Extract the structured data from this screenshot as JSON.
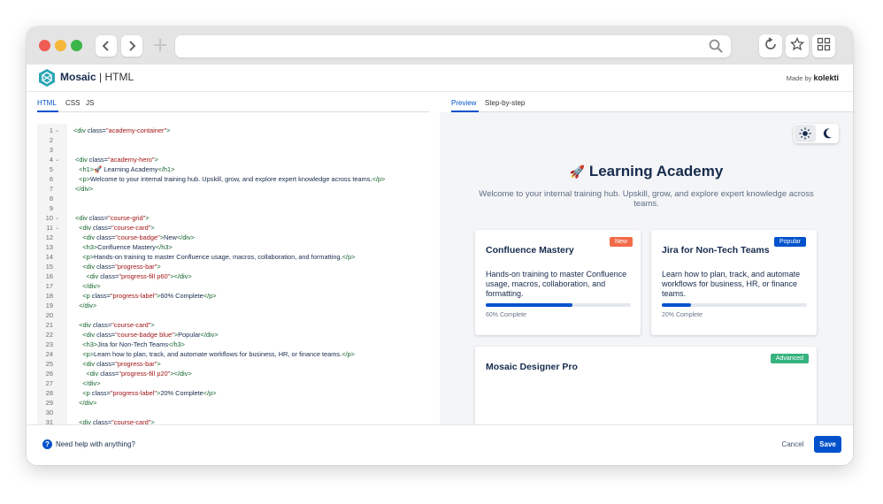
{
  "browser": {
    "back_icon": "chevron-left-icon",
    "forward_icon": "chevron-right-icon",
    "new_tab_icon": "plus-icon",
    "url": "",
    "reload_icon": "reload-icon",
    "bookmark_icon": "star-icon",
    "apps_icon": "grid-icon"
  },
  "app": {
    "name": "Mosaic",
    "separator": "|",
    "subtitle": "HTML",
    "made_by_prefix": "Made by",
    "made_by_brand": "kolekti"
  },
  "editor_tabs": [
    {
      "label": "HTML",
      "active": true
    },
    {
      "label": "CSS",
      "active": false
    },
    {
      "label": "JS",
      "active": false
    }
  ],
  "code_lines": [
    {
      "n": "1",
      "fold": true,
      "parts": [
        [
          "t",
          "<div "
        ],
        [
          "a",
          "class="
        ],
        [
          "s",
          "\"academy-container\""
        ],
        [
          "t",
          ">"
        ]
      ]
    },
    {
      "n": "2",
      "fold": false,
      "parts": []
    },
    {
      "n": "3",
      "fold": false,
      "parts": []
    },
    {
      "n": "4",
      "fold": true,
      "parts": [
        [
          "t",
          " <div "
        ],
        [
          "a",
          "class="
        ],
        [
          "s",
          "\"academy-hero\""
        ],
        [
          "t",
          ">"
        ]
      ]
    },
    {
      "n": "5",
      "fold": false,
      "parts": [
        [
          "t",
          "   <h1>"
        ],
        [
          "a",
          "🚀 Learning Academy"
        ],
        [
          "t",
          "</h1>"
        ]
      ]
    },
    {
      "n": "6",
      "fold": false,
      "parts": [
        [
          "t",
          "   <p>"
        ],
        [
          "a",
          "Welcome to your internal training hub. Upskill, grow, and explore expert knowledge across teams."
        ],
        [
          "t",
          "</p>"
        ]
      ]
    },
    {
      "n": "7",
      "fold": false,
      "parts": [
        [
          "t",
          " </div>"
        ]
      ]
    },
    {
      "n": "8",
      "fold": false,
      "parts": []
    },
    {
      "n": "9",
      "fold": false,
      "parts": []
    },
    {
      "n": "10",
      "fold": true,
      "parts": [
        [
          "t",
          " <div "
        ],
        [
          "a",
          "class="
        ],
        [
          "s",
          "\"course-grid\""
        ],
        [
          "t",
          ">"
        ]
      ]
    },
    {
      "n": "11",
      "fold": true,
      "parts": [
        [
          "t",
          "   <div "
        ],
        [
          "a",
          "class="
        ],
        [
          "s",
          "\"course-card\""
        ],
        [
          "t",
          ">"
        ]
      ]
    },
    {
      "n": "12",
      "fold": false,
      "parts": [
        [
          "t",
          "     <div "
        ],
        [
          "a",
          "class="
        ],
        [
          "s",
          "\"course-badge\""
        ],
        [
          "t",
          ">"
        ],
        [
          "a",
          "New"
        ],
        [
          "t",
          "</div>"
        ]
      ]
    },
    {
      "n": "13",
      "fold": false,
      "parts": [
        [
          "t",
          "     <h3>"
        ],
        [
          "a",
          "Confluence Mastery"
        ],
        [
          "t",
          "</h3>"
        ]
      ]
    },
    {
      "n": "14",
      "fold": false,
      "parts": [
        [
          "t",
          "     <p>"
        ],
        [
          "a",
          "Hands-on training to master Confluence usage, macros, collaboration, and formatting."
        ],
        [
          "t",
          "</p>"
        ]
      ]
    },
    {
      "n": "15",
      "fold": false,
      "parts": [
        [
          "t",
          "     <div "
        ],
        [
          "a",
          "class="
        ],
        [
          "s",
          "\"progress-bar\""
        ],
        [
          "t",
          ">"
        ]
      ]
    },
    {
      "n": "16",
      "fold": false,
      "parts": [
        [
          "t",
          "       <div "
        ],
        [
          "a",
          "class="
        ],
        [
          "s",
          "\"progress-fill p60\""
        ],
        [
          "t",
          "></div>"
        ]
      ]
    },
    {
      "n": "17",
      "fold": false,
      "parts": [
        [
          "t",
          "     </div>"
        ]
      ]
    },
    {
      "n": "18",
      "fold": false,
      "parts": [
        [
          "t",
          "     <p "
        ],
        [
          "a",
          "class="
        ],
        [
          "s",
          "\"progress-label\""
        ],
        [
          "t",
          ">"
        ],
        [
          "a",
          "60% Complete"
        ],
        [
          "t",
          "</p>"
        ]
      ]
    },
    {
      "n": "19",
      "fold": false,
      "parts": [
        [
          "t",
          "   </div>"
        ]
      ]
    },
    {
      "n": "20",
      "fold": false,
      "parts": []
    },
    {
      "n": "21",
      "fold": false,
      "parts": [
        [
          "t",
          "   <div "
        ],
        [
          "a",
          "class="
        ],
        [
          "s",
          "\"course-card\""
        ],
        [
          "t",
          ">"
        ]
      ]
    },
    {
      "n": "22",
      "fold": false,
      "parts": [
        [
          "t",
          "     <div "
        ],
        [
          "a",
          "class="
        ],
        [
          "s",
          "\"course-badge blue\""
        ],
        [
          "t",
          ">"
        ],
        [
          "a",
          "Popular"
        ],
        [
          "t",
          "</div>"
        ]
      ]
    },
    {
      "n": "23",
      "fold": false,
      "parts": [
        [
          "t",
          "     <h3>"
        ],
        [
          "a",
          "Jira for Non-Tech Teams"
        ],
        [
          "t",
          "</h3>"
        ]
      ]
    },
    {
      "n": "24",
      "fold": false,
      "parts": [
        [
          "t",
          "     <p>"
        ],
        [
          "a",
          "Learn how to plan, track, and automate workflows for business, HR, or finance teams."
        ],
        [
          "t",
          "</p>"
        ]
      ]
    },
    {
      "n": "25",
      "fold": false,
      "parts": [
        [
          "t",
          "     <div "
        ],
        [
          "a",
          "class="
        ],
        [
          "s",
          "\"progress-bar\""
        ],
        [
          "t",
          ">"
        ]
      ]
    },
    {
      "n": "26",
      "fold": false,
      "parts": [
        [
          "t",
          "       <div "
        ],
        [
          "a",
          "class="
        ],
        [
          "s",
          "\"progress-fill p20\""
        ],
        [
          "t",
          "></div>"
        ]
      ]
    },
    {
      "n": "27",
      "fold": false,
      "parts": [
        [
          "t",
          "     </div>"
        ]
      ]
    },
    {
      "n": "28",
      "fold": false,
      "parts": [
        [
          "t",
          "     <p "
        ],
        [
          "a",
          "class="
        ],
        [
          "s",
          "\"progress-label\""
        ],
        [
          "t",
          ">"
        ],
        [
          "a",
          "20% Complete"
        ],
        [
          "t",
          "</p>"
        ]
      ]
    },
    {
      "n": "29",
      "fold": false,
      "parts": [
        [
          "t",
          "   </div>"
        ]
      ]
    },
    {
      "n": "30",
      "fold": false,
      "parts": []
    },
    {
      "n": "31",
      "fold": false,
      "parts": [
        [
          "t",
          "   <div "
        ],
        [
          "a",
          "class="
        ],
        [
          "s",
          "\"course-card\""
        ],
        [
          "t",
          ">"
        ]
      ]
    }
  ],
  "preview_tabs": [
    {
      "label": "Preview",
      "active": true
    },
    {
      "label": "Step-by-step",
      "active": false
    }
  ],
  "preview": {
    "theme_light_icon": "sun-icon",
    "theme_dark_icon": "moon-icon",
    "title_emoji": "🚀",
    "title": "Learning Academy",
    "description": "Welcome to your internal training hub. Upskill, grow, and explore expert knowledge across teams.",
    "cards": [
      {
        "badge": "New",
        "badge_color": "#f26b48",
        "title": "Confluence Mastery",
        "text": "Hands-on training to master Confluence usage, macros, collaboration, and formatting.",
        "progress": 0.6,
        "progress_label": "60% Complete"
      },
      {
        "badge": "Popular",
        "badge_color": "#0052cc",
        "title": "Jira for Non-Tech Teams",
        "text": "Learn how to plan, track, and automate workflows for business, HR, or finance teams.",
        "progress": 0.2,
        "progress_label": "20% Complete"
      },
      {
        "badge": "Advanced",
        "badge_color": "#36b37e",
        "title": "Mosaic Designer Pro"
      }
    ]
  },
  "footer": {
    "help_icon": "question-circle-icon",
    "help_text": "Need help with anything?",
    "cancel_label": "Cancel",
    "save_label": "Save"
  },
  "colors": {
    "primary": "#0052cc",
    "text": "#172b4d",
    "tag": "#116329",
    "string": "#a31515"
  }
}
